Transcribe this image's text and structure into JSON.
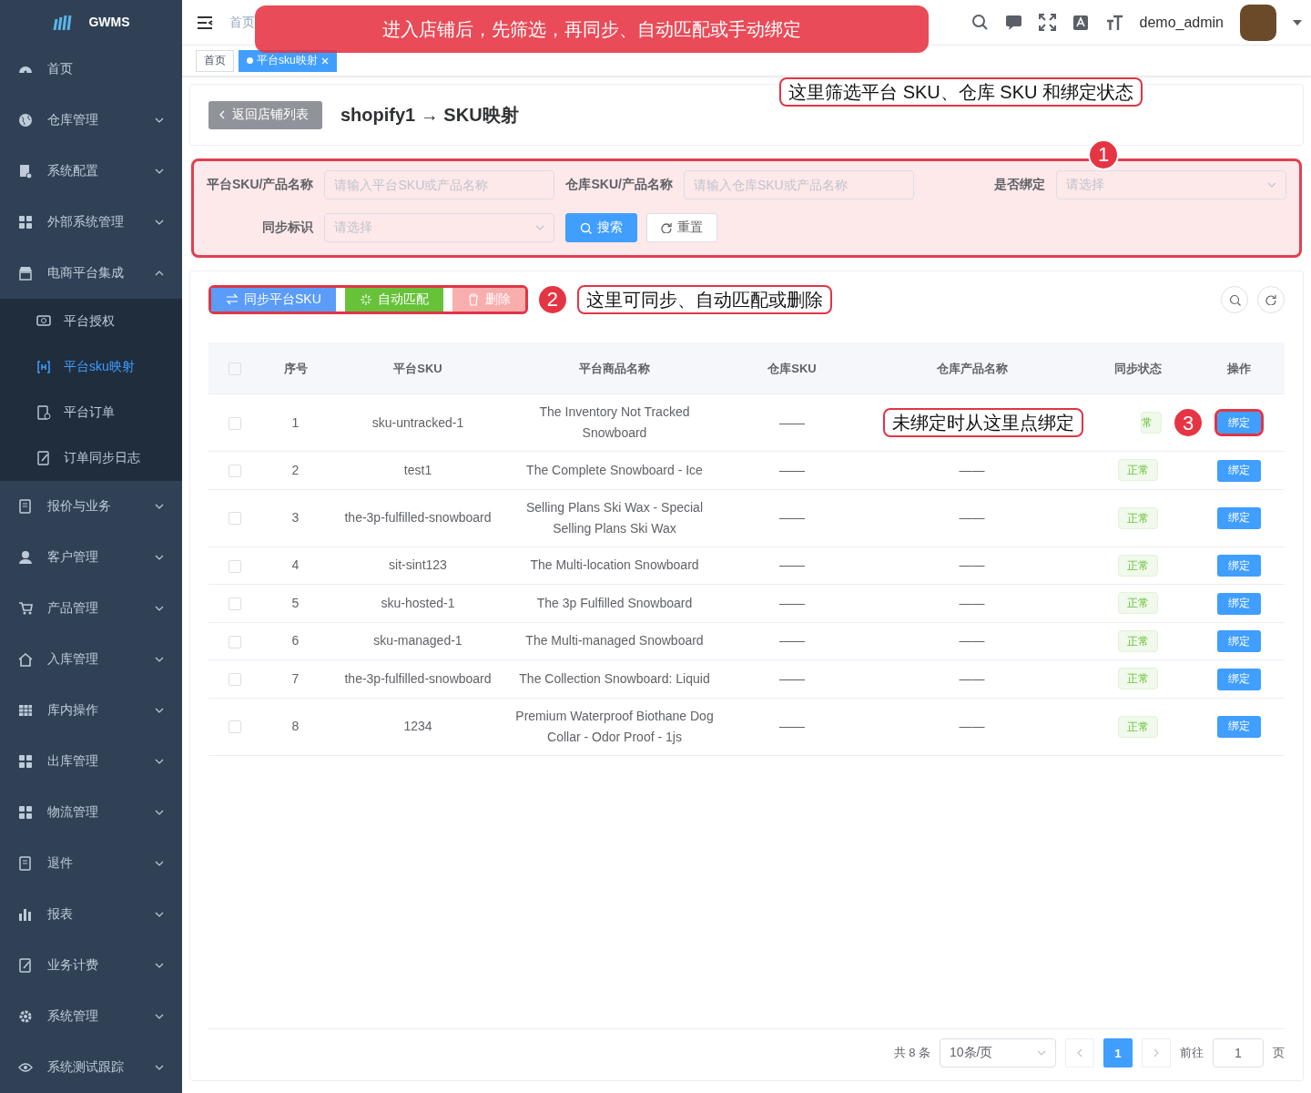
{
  "banner": {
    "text": "进入店铺后，先筛选，再同步、自动匹配或手动绑定"
  },
  "sidebar": {
    "logo": "GWMS",
    "items": [
      {
        "label": "首页",
        "expandable": false,
        "selected": false
      },
      {
        "label": "仓库管理",
        "expandable": true,
        "expanded": false,
        "selected": false
      },
      {
        "label": "系统配置",
        "expandable": true,
        "expanded": false,
        "selected": false
      },
      {
        "label": "外部系统管理",
        "expandable": true,
        "expanded": false,
        "selected": false
      },
      {
        "label": "电商平台集成",
        "expandable": true,
        "expanded": true,
        "selected": false,
        "children": [
          {
            "label": "平台授权",
            "selected": false
          },
          {
            "label": "平台sku映射",
            "selected": true
          },
          {
            "label": "平台订单",
            "selected": false
          },
          {
            "label": "订单同步日志",
            "selected": false
          }
        ]
      },
      {
        "label": "报价与业务",
        "expandable": true,
        "expanded": false,
        "selected": false
      },
      {
        "label": "客户管理",
        "expandable": true,
        "expanded": false,
        "selected": false
      },
      {
        "label": "产品管理",
        "expandable": true,
        "expanded": false,
        "selected": false
      },
      {
        "label": "入库管理",
        "expandable": true,
        "expanded": false,
        "selected": false
      },
      {
        "label": "库内操作",
        "expandable": true,
        "expanded": false,
        "selected": false
      },
      {
        "label": "出库管理",
        "expandable": true,
        "expanded": false,
        "selected": false
      },
      {
        "label": "物流管理",
        "expandable": true,
        "expanded": false,
        "selected": false
      },
      {
        "label": "退件",
        "expandable": true,
        "expanded": false,
        "selected": false
      },
      {
        "label": "报表",
        "expandable": true,
        "expanded": false,
        "selected": false
      },
      {
        "label": "业务计费",
        "expandable": true,
        "expanded": false,
        "selected": false
      },
      {
        "label": "系统管理",
        "expandable": true,
        "expanded": false,
        "selected": false
      },
      {
        "label": "系统测试跟踪",
        "expandable": true,
        "expanded": false,
        "selected": false
      }
    ]
  },
  "header": {
    "breadcrumb": [
      "首页"
    ],
    "user": "demo_admin"
  },
  "tabs": [
    {
      "label": "首页",
      "selected": false,
      "closable": false
    },
    {
      "label": "平台sku映射",
      "selected": true,
      "closable": true
    }
  ],
  "page": {
    "back_button": "返回店铺列表",
    "title": "shopify1 → SKU映射",
    "note": "这里筛选平台 SKU、仓库 SKU 和绑定状态"
  },
  "filter": {
    "marker": "1",
    "fields": [
      {
        "label": "平台SKU/产品名称",
        "kind": "input",
        "placeholder": "请输入平台SKU或产品名称"
      },
      {
        "label": "仓库SKU/产品名称",
        "kind": "input",
        "placeholder": "请输入仓库SKU或产品名称"
      },
      {
        "label": "是否绑定",
        "kind": "select",
        "placeholder": "请选择"
      },
      {
        "label": "同步标识",
        "kind": "select",
        "placeholder": "请选择"
      }
    ],
    "search_button": "搜索",
    "reset_button": "重置"
  },
  "toolbar": {
    "marker": "2",
    "note": "这里可同步、自动匹配或删除",
    "buttons": [
      {
        "label": "同步平台SKU",
        "kind": "sync",
        "disabled": false
      },
      {
        "label": "自动匹配",
        "kind": "match",
        "disabled": false
      },
      {
        "label": "删除",
        "kind": "delete",
        "disabled": true
      }
    ]
  },
  "table": {
    "all_checked": false,
    "columns": [
      "序号",
      "平台SKU",
      "平台商品名称",
      "仓库SKU",
      "仓库产品名称",
      "同步状态",
      "操作"
    ],
    "rows": [
      {
        "checked": false,
        "cells": [
          "1",
          "sku-untracked-1",
          "The Inventory Not Tracked Snowboard",
          "——",
          ""
        ],
        "status": "常",
        "action": "绑定",
        "marker": "3",
        "note": "未绑定时从这里点绑定"
      },
      {
        "checked": false,
        "cells": [
          "2",
          "test1",
          "The Complete Snowboard - Ice",
          "——",
          "——"
        ],
        "status": "正常",
        "action": "绑定"
      },
      {
        "checked": false,
        "cells": [
          "3",
          "the-3p-fulfilled-snowboard",
          "Selling Plans Ski Wax - Special Selling Plans Ski Wax",
          "——",
          "——"
        ],
        "status": "正常",
        "action": "绑定"
      },
      {
        "checked": false,
        "cells": [
          "4",
          "sit-sint123",
          "The Multi-location Snowboard",
          "——",
          "——"
        ],
        "status": "正常",
        "action": "绑定"
      },
      {
        "checked": false,
        "cells": [
          "5",
          "sku-hosted-1",
          "The 3p Fulfilled Snowboard",
          "——",
          "——"
        ],
        "status": "正常",
        "action": "绑定"
      },
      {
        "checked": false,
        "cells": [
          "6",
          "sku-managed-1",
          "The Multi-managed Snowboard",
          "——",
          "——"
        ],
        "status": "正常",
        "action": "绑定"
      },
      {
        "checked": false,
        "cells": [
          "7",
          "the-3p-fulfilled-snowboard",
          "The Collection Snowboard: Liquid",
          "——",
          "——"
        ],
        "status": "正常",
        "action": "绑定"
      },
      {
        "checked": false,
        "cells": [
          "8",
          "1234",
          "Premium Waterproof Biothane Dog Collar - Odor Proof - 1js",
          "——",
          "——"
        ],
        "status": "正常",
        "action": "绑定"
      }
    ]
  },
  "pagination": {
    "total": "共 8 条",
    "page_size": "10条/页",
    "pages": [
      {
        "label": "1",
        "selected": true
      }
    ],
    "goto_label": "前往",
    "goto_value": "1",
    "goto_suffix": "页"
  }
}
